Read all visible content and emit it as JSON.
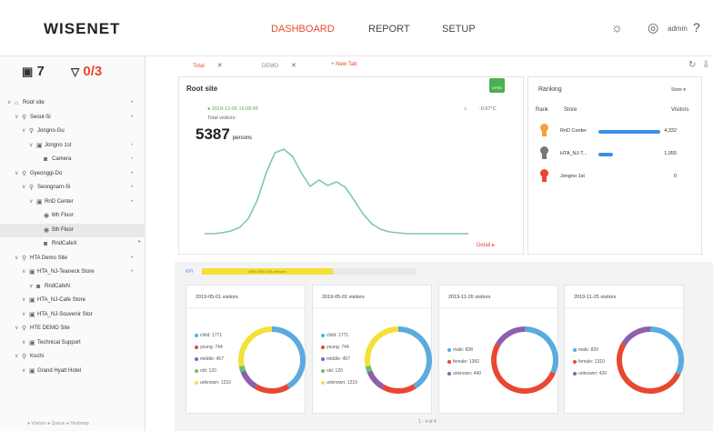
{
  "header": {
    "logo": "WISENET",
    "nav": [
      "DASHBOARD",
      "REPORT",
      "SETUP"
    ],
    "active_nav": "DASHBOARD",
    "user": "admin",
    "icons": [
      "settings-icon",
      "user-circle-icon",
      "help-icon"
    ]
  },
  "sidebar": {
    "store_count": "7",
    "sensor_status": "0/3",
    "tree": [
      {
        "label": "Root site",
        "depth": 0,
        "icon": "home-icon",
        "dot": "blue"
      },
      {
        "label": "Seoul-Si",
        "depth": 1,
        "icon": "pin-icon",
        "dot": "blue"
      },
      {
        "label": "Jongno-Gu",
        "depth": 2,
        "icon": "pin-icon",
        "dot": ""
      },
      {
        "label": "Jongno 1st",
        "depth": 3,
        "icon": "store-icon",
        "dot": "orange"
      },
      {
        "label": "Camera",
        "depth": 4,
        "icon": "camera-icon",
        "dot": "orange"
      },
      {
        "label": "Gyeonggi-Do",
        "depth": 1,
        "icon": "pin-icon",
        "dot": "blue"
      },
      {
        "label": "Seongnam-Si",
        "depth": 2,
        "icon": "pin-icon",
        "dot": "blue"
      },
      {
        "label": "RnD Center",
        "depth": 3,
        "icon": "store-icon",
        "dot": "blue"
      },
      {
        "label": "6th Floor",
        "depth": 4,
        "icon": "floor-icon",
        "dot": ""
      },
      {
        "label": "5th Floor",
        "depth": 4,
        "icon": "floor-icon",
        "dot": "",
        "selected": true
      },
      {
        "label": "RndCafeX",
        "depth": 4,
        "icon": "camera-icon",
        "dot": ""
      },
      {
        "label": "HTA Demo Site",
        "depth": 1,
        "icon": "pin-icon",
        "dot": "blue"
      },
      {
        "label": "HTA_NJ-Teaneck Store",
        "depth": 2,
        "icon": "store-icon",
        "dot": "blue"
      },
      {
        "label": "RndCafeN",
        "depth": 3,
        "icon": "camera-icon",
        "dot": ""
      },
      {
        "label": "HTA_NJ-Cafe Store",
        "depth": 2,
        "icon": "store-icon",
        "dot": ""
      },
      {
        "label": "HTA_NJ-Souvenir Stor",
        "depth": 2,
        "icon": "store-icon",
        "dot": ""
      },
      {
        "label": "HTE DEMO Site",
        "depth": 1,
        "icon": "pin-icon",
        "dot": ""
      },
      {
        "label": "Technical Support",
        "depth": 2,
        "icon": "store-icon",
        "dot": ""
      },
      {
        "label": "Kochi",
        "depth": 1,
        "icon": "pin-icon",
        "dot": ""
      },
      {
        "label": "Grand Hyatt Hotel",
        "depth": 2,
        "icon": "store-icon",
        "dot": ""
      }
    ],
    "legend": "● Visitors  ● Queue  ● Heatmap"
  },
  "tabs": [
    {
      "label": "Total",
      "active": true
    },
    {
      "label": "DEMO",
      "active": false
    }
  ],
  "new_tab": "+ New Tab",
  "site_card": {
    "title": "Root site",
    "badge": "OPEN",
    "datetime": "● 2019-12-05  16:08:45",
    "temperature": "-0.57°C",
    "visitors_label": "Total visitors:",
    "visitors_value": "5387",
    "visitors_unit": "persons",
    "detail": "Detail ▸"
  },
  "ranking": {
    "title": "Ranking",
    "selector": "Store ▾",
    "headers": [
      "Rank",
      "Store",
      "Visitors"
    ],
    "rows": [
      {
        "store": "RnD Center",
        "visitors": "4,332",
        "fraction": 1.0,
        "medal": "#f2a33a"
      },
      {
        "store": "HTA_NJ-T...",
        "visitors": "1,055",
        "fraction": 0.24,
        "medal": "#777777"
      },
      {
        "store": "Jongno 1st",
        "visitors": "0",
        "fraction": 0,
        "medal": "#e8482f"
      }
    ]
  },
  "kpi": {
    "label": "KPI",
    "bar_text": "8000 /800 000 persons",
    "fraction": 0.61
  },
  "chart_data": [
    {
      "type": "line",
      "title": "",
      "x": [
        0,
        1,
        2,
        3,
        4,
        5,
        6,
        7,
        8,
        9,
        10,
        11,
        12,
        13,
        14,
        15,
        16,
        17,
        18,
        19,
        20,
        21,
        22,
        23,
        24,
        25,
        26,
        27,
        28,
        29,
        30
      ],
      "series": [
        {
          "values": [
            3,
            3,
            4,
            6,
            10,
            20,
            40,
            70,
            92,
            96,
            88,
            70,
            55,
            62,
            56,
            60,
            54,
            40,
            25,
            14,
            8,
            5,
            4,
            3,
            3,
            3,
            3,
            3,
            3,
            3,
            3
          ]
        }
      ],
      "color": "#7cc9a9"
    },
    {
      "type": "pie",
      "title": "2019-05-01 visitors",
      "labels": [
        "child",
        "young",
        "middle",
        "old",
        "unknown"
      ],
      "values": [
        1771,
        744,
        457,
        120,
        1210
      ],
      "colors": [
        "#5aabde",
        "#e8482f",
        "#8e5fae",
        "#66c26e",
        "#f5e034"
      ]
    },
    {
      "type": "pie",
      "title": "2019-05-01 visitors",
      "labels": [
        "child",
        "young",
        "middle",
        "old",
        "unknown"
      ],
      "values": [
        1771,
        744,
        457,
        120,
        1210
      ],
      "colors": [
        "#5aabde",
        "#e8482f",
        "#8e5fae",
        "#66c26e",
        "#f5e034"
      ]
    },
    {
      "type": "pie",
      "title": "2019-11-26 visitors",
      "labels": [
        "male",
        "female",
        "unknown"
      ],
      "values": [
        828,
        1360,
        440
      ],
      "colors": [
        "#5aabde",
        "#e8482f",
        "#8e5fae"
      ]
    },
    {
      "type": "pie",
      "title": "2019-11-25 visitors",
      "labels": [
        "male",
        "female",
        "unknown"
      ],
      "values": [
        820,
        1310,
        420
      ],
      "colors": [
        "#5aabde",
        "#e8482f",
        "#8e5fae"
      ]
    }
  ],
  "pager": "1 - 4 of 4"
}
